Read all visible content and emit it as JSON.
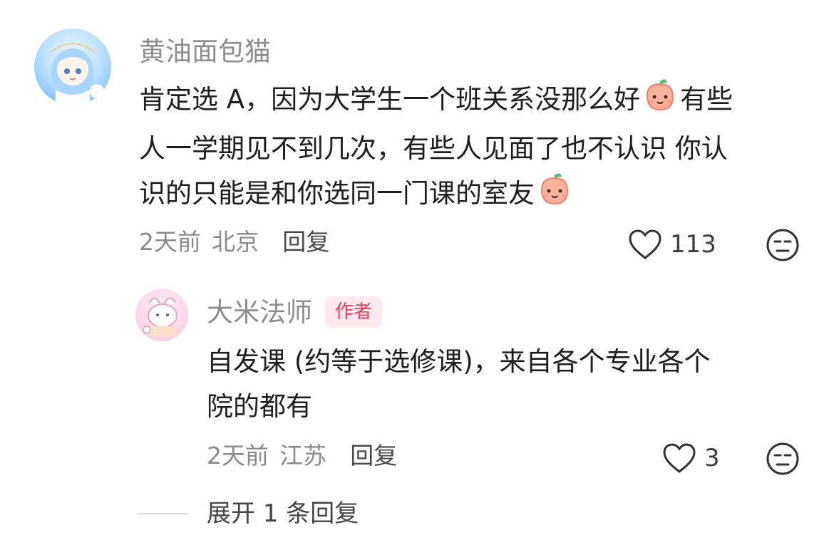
{
  "comment": {
    "username": "黄油面包猫",
    "text_parts": [
      "肯定选 A，因为大学生一个班关系没那么好",
      "有些",
      "人一学期见不到几次，有些人见面了也不认识 你认",
      "识的只能是和你选同一门课的室友"
    ],
    "time": "2天前",
    "location": "北京",
    "reply_label": "回复",
    "likes": "113"
  },
  "reply": {
    "username": "大米法师",
    "badge": "作者",
    "text_parts": [
      "自发课 (约等于选修课)，来自各个专业各个",
      "院的都有"
    ],
    "time": "2天前",
    "location": "江苏",
    "reply_label": "回复",
    "likes": "3"
  },
  "expand_label": "展开 1 条回复",
  "icons": [
    "heart-icon",
    "neutral-face-icon",
    "peach-emoji-icon"
  ],
  "colors": {
    "badge_bg": "#ffe8ee",
    "badge_text": "#ea3d5c",
    "muted": "#8b8b8b"
  }
}
